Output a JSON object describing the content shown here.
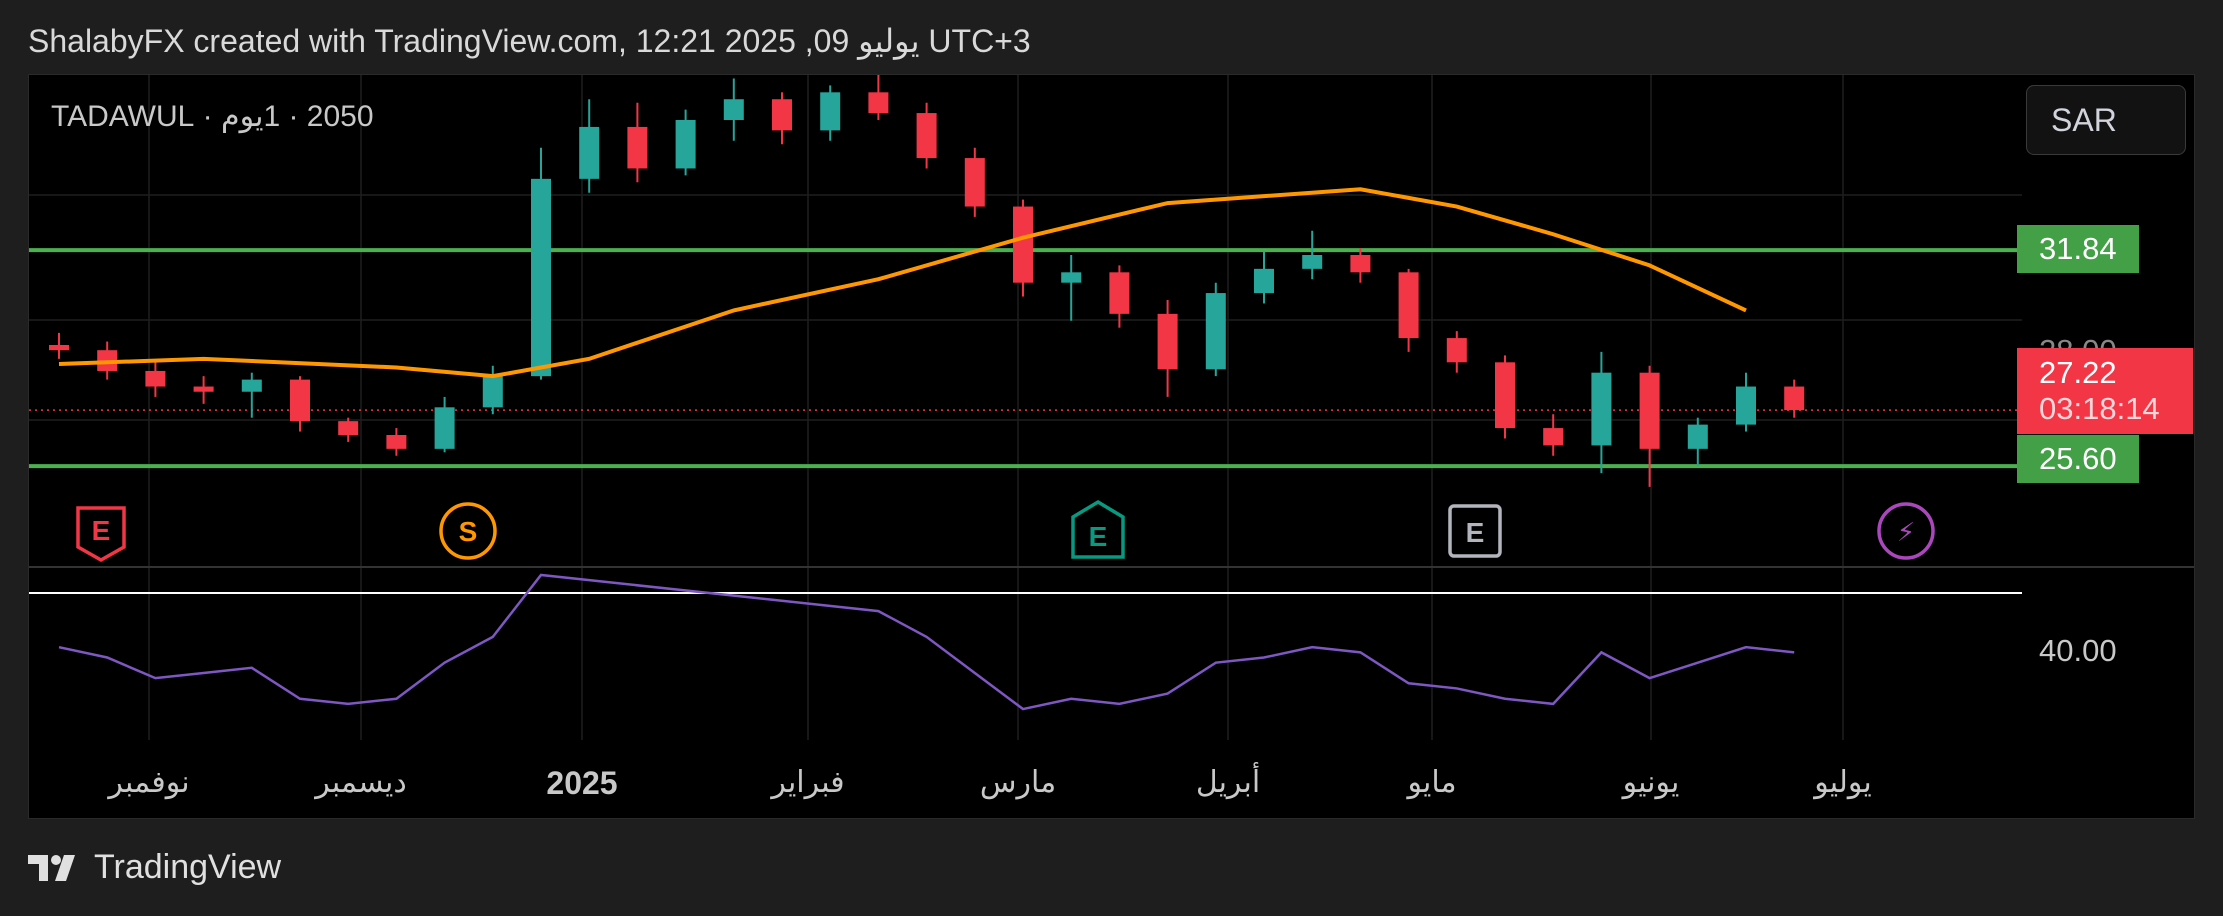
{
  "header": {
    "caption": "ShalabyFX created with TradingView.com, 12:21 2025 ,09 يوليو UTC+3"
  },
  "legend": {
    "symbol_line": "2050 · 1يوم · TADAWUL"
  },
  "controls": {
    "currency": "SAR"
  },
  "price_scale": {
    "resistance_label": "31.84",
    "hidden_label": "28.00",
    "last_price_label": "27.22",
    "countdown": "03:18:14",
    "support_label": "25.60",
    "rsi_label": "40.00"
  },
  "time_axis": {
    "labels": [
      "نوفمبر",
      "ديسمبر",
      "2025",
      "فبراير",
      "مارس",
      "أبريل",
      "مايو",
      "يونيو",
      "يوليو"
    ]
  },
  "events": [
    {
      "letter": "E",
      "kind": "earnings-past",
      "color": "#f23645"
    },
    {
      "letter": "S",
      "kind": "split",
      "color": "#ff9800"
    },
    {
      "letter": "E",
      "kind": "earnings-recent",
      "color": "#089981"
    },
    {
      "letter": "E",
      "kind": "earnings-upcoming",
      "color": "#b2b5be"
    },
    {
      "letter": "⚡",
      "kind": "news",
      "color": "#ab47bc"
    }
  ],
  "colors": {
    "up": "#26a69a",
    "down": "#f23645",
    "ma": "#ff9800",
    "levels": "#4caf50",
    "rsi": "#7e57c2"
  },
  "brand": {
    "name": "TradingView"
  },
  "chart_data": {
    "type": "candlestick",
    "symbol": "2050",
    "exchange": "TADAWUL",
    "interval": "1D",
    "currency": "SAR",
    "last_price": 27.22,
    "support": 25.6,
    "resistance": 31.84,
    "price_range": [
      23.9,
      36.9
    ],
    "candles": [
      {
        "t": "Oct 29",
        "o": 29.1,
        "h": 29.45,
        "l": 28.7,
        "c": 28.95
      },
      {
        "t": "Nov 05",
        "o": 28.95,
        "h": 29.2,
        "l": 28.1,
        "c": 28.35
      },
      {
        "t": "Nov 12",
        "o": 28.35,
        "h": 28.6,
        "l": 27.6,
        "c": 27.9
      },
      {
        "t": "Nov 19",
        "o": 27.9,
        "h": 28.2,
        "l": 27.4,
        "c": 27.75
      },
      {
        "t": "Nov 26",
        "o": 27.75,
        "h": 28.3,
        "l": 27.0,
        "c": 28.1
      },
      {
        "t": "Dec 03",
        "o": 28.1,
        "h": 28.2,
        "l": 26.6,
        "c": 26.9
      },
      {
        "t": "Dec 10",
        "o": 26.9,
        "h": 27.0,
        "l": 26.3,
        "c": 26.5
      },
      {
        "t": "Dec 17",
        "o": 26.5,
        "h": 26.7,
        "l": 25.9,
        "c": 26.1
      },
      {
        "t": "Dec 24",
        "o": 26.1,
        "h": 27.6,
        "l": 26.0,
        "c": 27.3
      },
      {
        "t": "Dec 31",
        "o": 27.3,
        "h": 28.5,
        "l": 27.1,
        "c": 28.2
      },
      {
        "t": "Jan 07",
        "o": 28.2,
        "h": 34.8,
        "l": 28.1,
        "c": 33.9
      },
      {
        "t": "Jan 14",
        "o": 33.9,
        "h": 36.2,
        "l": 33.5,
        "c": 35.4
      },
      {
        "t": "Jan 21",
        "o": 35.4,
        "h": 36.1,
        "l": 33.8,
        "c": 34.2
      },
      {
        "t": "Jan 28",
        "o": 34.2,
        "h": 35.9,
        "l": 34.0,
        "c": 35.6
      },
      {
        "t": "Feb 04",
        "o": 35.6,
        "h": 36.8,
        "l": 35.0,
        "c": 36.2
      },
      {
        "t": "Feb 11",
        "o": 36.2,
        "h": 36.4,
        "l": 34.9,
        "c": 35.3
      },
      {
        "t": "Feb 18",
        "o": 35.3,
        "h": 36.6,
        "l": 35.0,
        "c": 36.4
      },
      {
        "t": "Feb 25",
        "o": 36.4,
        "h": 36.9,
        "l": 35.6,
        "c": 35.8
      },
      {
        "t": "Mar 04",
        "o": 35.8,
        "h": 36.1,
        "l": 34.2,
        "c": 34.5
      },
      {
        "t": "Mar 11",
        "o": 34.5,
        "h": 34.8,
        "l": 32.8,
        "c": 33.1
      },
      {
        "t": "Mar 18",
        "o": 33.1,
        "h": 33.3,
        "l": 30.5,
        "c": 30.9
      },
      {
        "t": "Mar 25",
        "o": 30.9,
        "h": 31.7,
        "l": 29.8,
        "c": 31.2
      },
      {
        "t": "Apr 01",
        "o": 31.2,
        "h": 31.4,
        "l": 29.6,
        "c": 30.0
      },
      {
        "t": "Apr 08",
        "o": 30.0,
        "h": 30.4,
        "l": 27.6,
        "c": 28.4
      },
      {
        "t": "Apr 15",
        "o": 28.4,
        "h": 30.9,
        "l": 28.2,
        "c": 30.6
      },
      {
        "t": "Apr 22",
        "o": 30.6,
        "h": 31.8,
        "l": 30.3,
        "c": 31.3
      },
      {
        "t": "Apr 29",
        "o": 31.3,
        "h": 32.4,
        "l": 31.0,
        "c": 31.7
      },
      {
        "t": "May 06",
        "o": 31.7,
        "h": 31.9,
        "l": 30.9,
        "c": 31.2
      },
      {
        "t": "May 13",
        "o": 31.2,
        "h": 31.3,
        "l": 28.9,
        "c": 29.3
      },
      {
        "t": "May 20",
        "o": 29.3,
        "h": 29.5,
        "l": 28.3,
        "c": 28.6
      },
      {
        "t": "May 27",
        "o": 28.6,
        "h": 28.8,
        "l": 26.4,
        "c": 26.7
      },
      {
        "t": "Jun 03",
        "o": 26.7,
        "h": 27.1,
        "l": 25.9,
        "c": 26.2
      },
      {
        "t": "Jun 10",
        "o": 26.2,
        "h": 28.9,
        "l": 25.4,
        "c": 28.3
      },
      {
        "t": "Jun 17",
        "o": 28.3,
        "h": 28.5,
        "l": 25.0,
        "c": 26.1
      },
      {
        "t": "Jun 24",
        "o": 26.1,
        "h": 27.0,
        "l": 25.6,
        "c": 26.8
      },
      {
        "t": "Jul 01",
        "o": 26.8,
        "h": 28.3,
        "l": 26.6,
        "c": 27.9
      },
      {
        "t": "Jul 08",
        "o": 27.9,
        "h": 28.1,
        "l": 27.0,
        "c": 27.22
      }
    ],
    "moving_average": [
      {
        "t": "Oct 29",
        "v": 28.55
      },
      {
        "t": "Nov 19",
        "v": 28.7
      },
      {
        "t": "Dec 17",
        "v": 28.45
      },
      {
        "t": "Dec 31",
        "v": 28.2
      },
      {
        "t": "Jan 14",
        "v": 28.7
      },
      {
        "t": "Feb 04",
        "v": 30.1
      },
      {
        "t": "Feb 25",
        "v": 31.0
      },
      {
        "t": "Mar 18",
        "v": 32.2
      },
      {
        "t": "Apr 08",
        "v": 33.2
      },
      {
        "t": "Apr 22",
        "v": 33.4
      },
      {
        "t": "May 06",
        "v": 33.6
      },
      {
        "t": "May 20",
        "v": 33.1
      },
      {
        "t": "Jun 03",
        "v": 32.3
      },
      {
        "t": "Jun 17",
        "v": 31.4
      },
      {
        "t": "Jul 01",
        "v": 30.1
      }
    ],
    "rsi": {
      "level_label": 40.0,
      "series": [
        {
          "t": "Oct 29",
          "v": 48
        },
        {
          "t": "Nov 05",
          "v": 46
        },
        {
          "t": "Nov 12",
          "v": 42
        },
        {
          "t": "Nov 19",
          "v": 43
        },
        {
          "t": "Nov 26",
          "v": 44
        },
        {
          "t": "Dec 03",
          "v": 38
        },
        {
          "t": "Dec 10",
          "v": 37
        },
        {
          "t": "Dec 17",
          "v": 38
        },
        {
          "t": "Dec 24",
          "v": 45
        },
        {
          "t": "Dec 31",
          "v": 50
        },
        {
          "t": "Jan 07",
          "v": 62
        },
        {
          "t": "Feb 25",
          "v": 55
        },
        {
          "t": "Mar 04",
          "v": 50
        },
        {
          "t": "Mar 11",
          "v": 43
        },
        {
          "t": "Mar 18",
          "v": 36
        },
        {
          "t": "Mar 25",
          "v": 38
        },
        {
          "t": "Apr 01",
          "v": 37
        },
        {
          "t": "Apr 08",
          "v": 39
        },
        {
          "t": "Apr 15",
          "v": 45
        },
        {
          "t": "Apr 22",
          "v": 46
        },
        {
          "t": "Apr 29",
          "v": 48
        },
        {
          "t": "May 06",
          "v": 47
        },
        {
          "t": "May 13",
          "v": 41
        },
        {
          "t": "May 20",
          "v": 40
        },
        {
          "t": "May 27",
          "v": 38
        },
        {
          "t": "Jun 03",
          "v": 37
        },
        {
          "t": "Jun 10",
          "v": 47
        },
        {
          "t": "Jun 17",
          "v": 42
        },
        {
          "t": "Jun 24",
          "v": 45
        },
        {
          "t": "Jul 01",
          "v": 48
        },
        {
          "t": "Jul 08",
          "v": 47
        }
      ]
    },
    "xlabels": [
      "نوفمبر",
      "ديسمبر",
      "2025",
      "فبراير",
      "مارس",
      "أبريل",
      "مايو",
      "يونيو",
      "يوليو"
    ],
    "grid": true
  }
}
